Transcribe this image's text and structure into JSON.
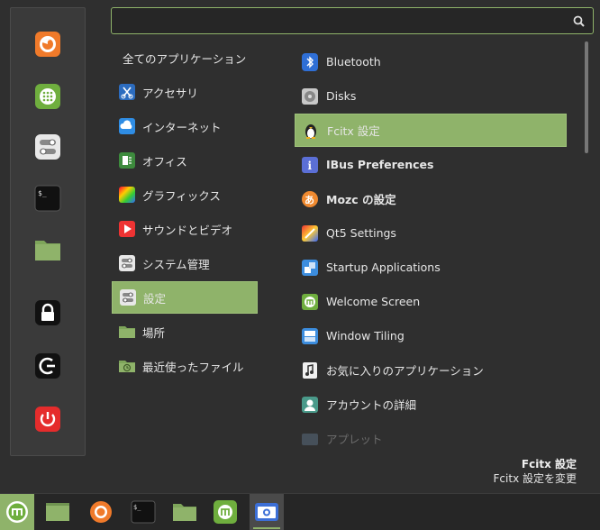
{
  "search": {
    "value": "",
    "placeholder": ""
  },
  "favorites": [
    {
      "name": "firefox-icon"
    },
    {
      "name": "software-manager-icon"
    },
    {
      "name": "settings-toggle-icon"
    },
    {
      "name": "terminal-icon"
    },
    {
      "name": "folder-icon"
    },
    {
      "name": "lock-screen-icon"
    },
    {
      "name": "logout-icon"
    },
    {
      "name": "power-icon"
    }
  ],
  "categories": [
    {
      "label": "全てのアプリケーション",
      "icon": ""
    },
    {
      "label": "アクセサリ",
      "icon": "accessories-icon"
    },
    {
      "label": "インターネット",
      "icon": "internet-icon"
    },
    {
      "label": "オフィス",
      "icon": "office-icon"
    },
    {
      "label": "グラフィックス",
      "icon": "graphics-icon"
    },
    {
      "label": "サウンドとビデオ",
      "icon": "sound-video-icon"
    },
    {
      "label": "システム管理",
      "icon": "system-admin-icon"
    },
    {
      "label": "設定",
      "icon": "settings-icon",
      "selected": true
    },
    {
      "label": "場所",
      "icon": "places-folder-icon"
    },
    {
      "label": "最近使ったファイル",
      "icon": "recent-files-icon"
    }
  ],
  "apps": [
    {
      "label": "Bluetooth",
      "icon": "bluetooth-icon"
    },
    {
      "label": "Disks",
      "icon": "disks-icon"
    },
    {
      "label": "Fcitx 設定",
      "icon": "fcitx-icon",
      "selected": true
    },
    {
      "label": "IBus Preferences",
      "icon": "ibus-icon",
      "bold": true
    },
    {
      "label": "Mozc の設定",
      "icon": "mozc-icon",
      "bold": true
    },
    {
      "label": "Qt5 Settings",
      "icon": "qt5-icon"
    },
    {
      "label": "Startup Applications",
      "icon": "startup-icon"
    },
    {
      "label": "Welcome Screen",
      "icon": "welcome-icon"
    },
    {
      "label": "Window Tiling",
      "icon": "window-tiling-icon"
    },
    {
      "label": "お気に入りのアプリケーション",
      "icon": "favorite-apps-icon"
    },
    {
      "label": "アカウントの詳細",
      "icon": "account-icon"
    },
    {
      "label": "アプレット",
      "icon": "applets-icon",
      "dim": true
    }
  ],
  "description": {
    "title": "Fcitx 設定",
    "subtitle": "Fcitx 設定を変更"
  },
  "taskbar": [
    {
      "name": "mint-menu-icon"
    },
    {
      "name": "show-desktop-icon"
    },
    {
      "name": "firefox-icon"
    },
    {
      "name": "terminal-icon"
    },
    {
      "name": "files-icon"
    },
    {
      "name": "welcome-icon"
    },
    {
      "name": "screenshot-icon"
    }
  ],
  "colors": {
    "accent": "#8fb36a",
    "panel": "#2f2f2f",
    "sidebar": "#3a3a3a"
  }
}
